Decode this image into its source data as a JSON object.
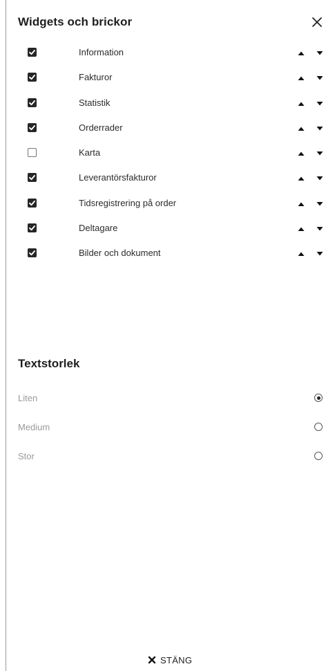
{
  "header": {
    "title": "Widgets och brickor",
    "close_icon": "close-icon"
  },
  "widgets": [
    {
      "label": "Information",
      "checked": true
    },
    {
      "label": "Fakturor",
      "checked": true
    },
    {
      "label": "Statistik",
      "checked": true
    },
    {
      "label": "Orderrader",
      "checked": true
    },
    {
      "label": "Karta",
      "checked": false
    },
    {
      "label": "Leverantörsfakturor",
      "checked": true
    },
    {
      "label": "Tidsregistrering på order",
      "checked": true
    },
    {
      "label": "Deltagare",
      "checked": true
    },
    {
      "label": "Bilder och dokument",
      "checked": true
    }
  ],
  "text_size": {
    "title": "Textstorlek",
    "options": [
      {
        "label": "Liten",
        "selected": true
      },
      {
        "label": "Medium",
        "selected": false
      },
      {
        "label": "Stor",
        "selected": false
      }
    ]
  },
  "footer": {
    "close_label": "STÄNG",
    "close_icon": "close-icon"
  },
  "colors": {
    "text": "#222222",
    "muted_text": "#9a9a9a",
    "checkbox_fill": "#262626",
    "border": "#9a9a9a"
  }
}
